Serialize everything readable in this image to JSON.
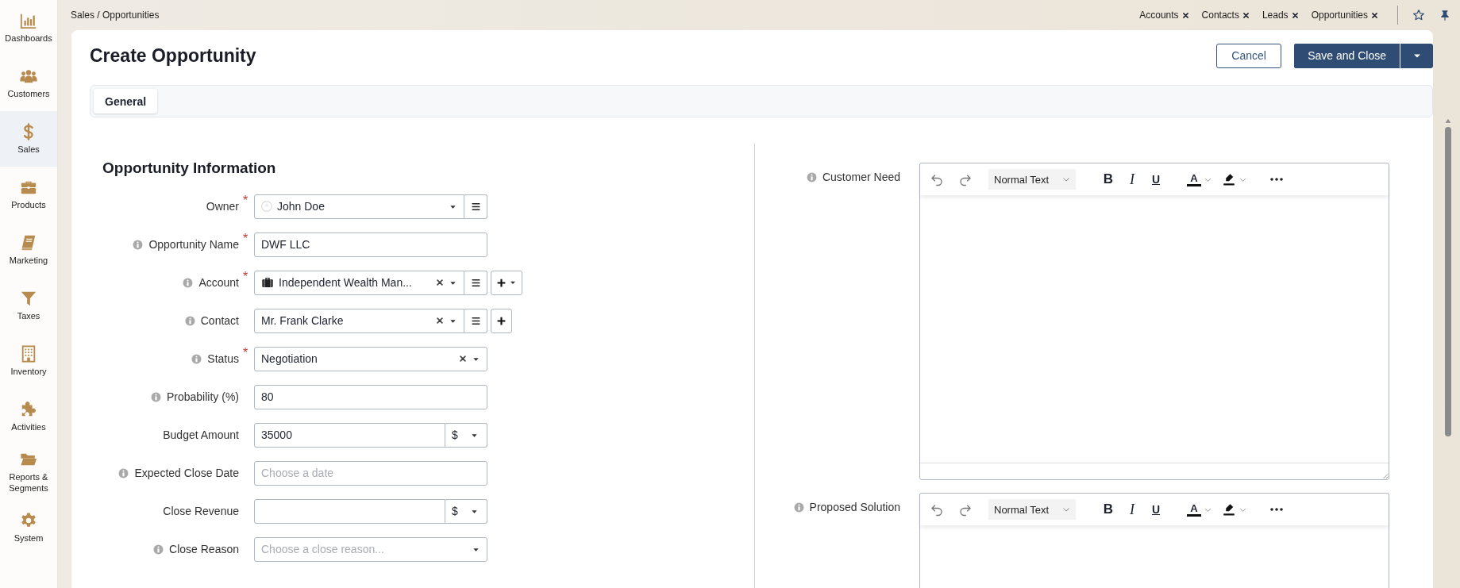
{
  "sidebar": {
    "items": [
      {
        "label": "Dashboards",
        "selected": false
      },
      {
        "label": "Customers",
        "selected": false
      },
      {
        "label": "Sales",
        "selected": true
      },
      {
        "label": "Products",
        "selected": false
      },
      {
        "label": "Marketing",
        "selected": false
      },
      {
        "label": "Taxes",
        "selected": false
      },
      {
        "label": "Inventory",
        "selected": false
      },
      {
        "label": "Activities",
        "selected": false
      },
      {
        "label": "Reports & Segments",
        "selected": false
      },
      {
        "label": "System",
        "selected": false
      }
    ]
  },
  "breadcrumb": "Sales / Opportunities",
  "recent_tabs": [
    {
      "label": "Accounts"
    },
    {
      "label": "Contacts"
    },
    {
      "label": "Leads"
    },
    {
      "label": "Opportunities"
    }
  ],
  "title": "Create Opportunity",
  "buttons": {
    "cancel": "Cancel",
    "save": "Save and Close"
  },
  "tabs": [
    {
      "label": "General",
      "selected": true
    }
  ],
  "section": {
    "title": "Opportunity Information",
    "fields": [
      {
        "label": "Owner",
        "required_mark": "*",
        "info": false,
        "kind": "user_select",
        "value": "John Doe",
        "clearable": false,
        "list_button": true,
        "add_button": false
      },
      {
        "label": "Opportunity Name",
        "required_mark": "*",
        "info": true,
        "kind": "text",
        "value": "DWF LLC"
      },
      {
        "label": "Account",
        "required_mark": "*",
        "info": true,
        "kind": "account_select",
        "value": "Independent Wealth Man...",
        "clearable": true,
        "list_button": true,
        "add_button": true,
        "add_menu": true
      },
      {
        "label": "Contact",
        "info": true,
        "kind": "select",
        "value": "Mr. Frank Clarke",
        "clearable": true,
        "list_button": true,
        "add_button": true,
        "add_menu": false
      },
      {
        "label": "Status",
        "required_mark": "*",
        "info": true,
        "kind": "select",
        "value": "Negotiation",
        "clearable": true,
        "list_button": false,
        "add_button": false
      },
      {
        "label": "Probability (%)",
        "info": true,
        "kind": "text",
        "value": "80"
      },
      {
        "label": "Budget Amount",
        "info": false,
        "kind": "money",
        "value": "35000",
        "currency": "$"
      },
      {
        "label": "Expected Close Date",
        "info": true,
        "kind": "text",
        "placeholder": "Choose a date"
      },
      {
        "label": "Close Revenue",
        "info": false,
        "kind": "money",
        "currency": "$"
      },
      {
        "label": "Close Reason",
        "info": true,
        "kind": "select",
        "placeholder": "Choose a close reason...",
        "clearable": false,
        "list_button": false,
        "add_button": false
      }
    ]
  },
  "editors": [
    {
      "label": "Customer Need",
      "info": true,
      "format": "Normal Text",
      "bold": "B",
      "italic": "I",
      "underline": "U",
      "font_color": "A",
      "resizable": true
    },
    {
      "label": "Proposed Solution",
      "info": true,
      "format": "Normal Text",
      "bold": "B",
      "italic": "I",
      "underline": "U",
      "font_color": "A"
    }
  ]
}
